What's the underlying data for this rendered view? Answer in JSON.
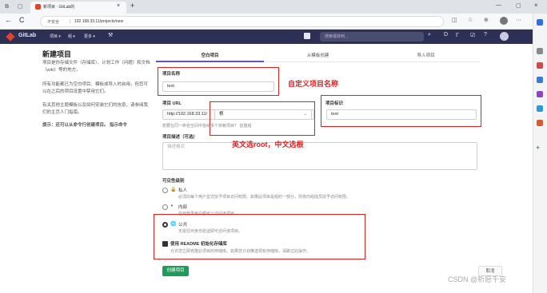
{
  "browser": {
    "tab_title": "新项目 · GitLab的",
    "new_tab_icon": "+",
    "security": "不安全",
    "url": "192.168.33.11/projects/new",
    "back_icon": "←",
    "refresh_icon": "C"
  },
  "nav": {
    "brand": "GitLab",
    "menu1": "项目 ▾",
    "menu2": "组 ▾",
    "menu3": "更多 ▾",
    "search_placeholder": "搜索或转到..."
  },
  "left": {
    "title": "新建项目",
    "p1": "项目是你存储文件（存储库）、计划工作（问题）和文档（wiki）等的地方。",
    "p2": "所有功能都已为空白项目、模板或导入时启用，但您可以在之后的项目设置中禁用它们。",
    "p3": "有关其他主题模板以及如何安装它们的信息，请参阅我们的主页人门指南。",
    "p4": "提示：还可以从命令行创建项目。 指示命令"
  },
  "tabs": [
    "空白项目",
    "从模板创建",
    "导入项目"
  ],
  "form": {
    "name_label": "项目名称",
    "name_value": "test",
    "url_label": "项目 URL",
    "url_prefix": "http://192.168.33.11/",
    "namespace": "根",
    "slug_label": "项目标识",
    "slug_value": "test",
    "url_help": "想要在同一命名空间中容纳多个依赖项目？ 创建组",
    "desc_label": "项目描述（可选）",
    "desc_placeholder": "描述格式",
    "visibility_label": "可见性级别",
    "private_title": "私人",
    "private_desc": "必须向每个用户显式授予项目访问权限。如果此项目是组的一部分，则将向组成员授予访问权限。",
    "internal_title": "内部",
    "internal_desc": "任何登录用户都可以访问该项目",
    "public_title": "公共",
    "public_desc": "无需任何身份验证即可访问该项目。",
    "readme_title": "使用 README 初始化存储库",
    "readme_desc": "允许您立即克隆此项目的存储库。如果您计划推送现有存储库，请跳过此操作。",
    "create_button": "创建项目",
    "cancel_button": "取消"
  },
  "annotations": {
    "a1": "自定义项目名称",
    "a2": "英文选root，中文选根"
  },
  "watermark": "CSDN @祈愿千安"
}
